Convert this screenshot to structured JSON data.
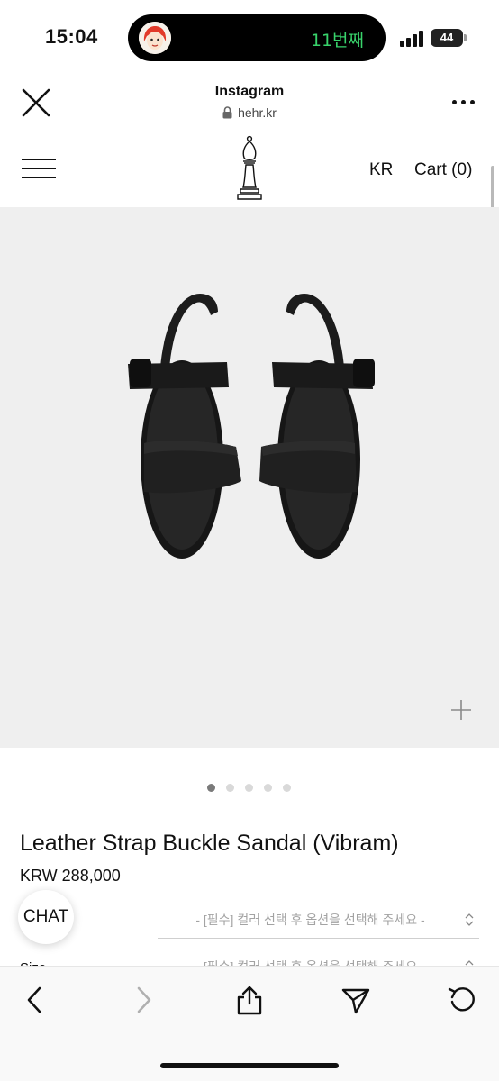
{
  "status_bar": {
    "time": "15:04",
    "live_activity_text": "11번째",
    "battery_level": "44",
    "icons": [
      "avatar-icon",
      "signal-icon",
      "battery-icon"
    ]
  },
  "browser": {
    "title": "Instagram",
    "url": "hehr.kr",
    "icons": [
      "close-icon",
      "lock-icon",
      "more-icon"
    ]
  },
  "site_nav": {
    "language": "KR",
    "cart_label": "Cart (0)",
    "icons": [
      "menu-icon",
      "chess-bishop-logo"
    ]
  },
  "gallery": {
    "image_subject": "black leather strap buckle sandals",
    "slide_count": 5,
    "active_slide": 1,
    "icons": [
      "zoom-plus-icon"
    ]
  },
  "product": {
    "title": "Leather Strap Buckle Sandal (Vibram)",
    "price": "KRW 288,000"
  },
  "options": [
    {
      "label": "",
      "placeholder": "- [필수] 컬러 선택 후 옵션을 선택해 주세요 -"
    },
    {
      "label": "Size",
      "placeholder": "- [필수] 컬러 선택 후 옵션을 선택해 주세요 -"
    }
  ],
  "chat_label": "CHAT",
  "toolbar": {
    "icons": [
      "back-icon",
      "forward-icon",
      "share-icon",
      "send-icon",
      "reload-icon"
    ]
  },
  "colors": {
    "island_text": "#38d36b",
    "image_background": "#efefef",
    "placeholder_text": "#a3a3a3"
  }
}
